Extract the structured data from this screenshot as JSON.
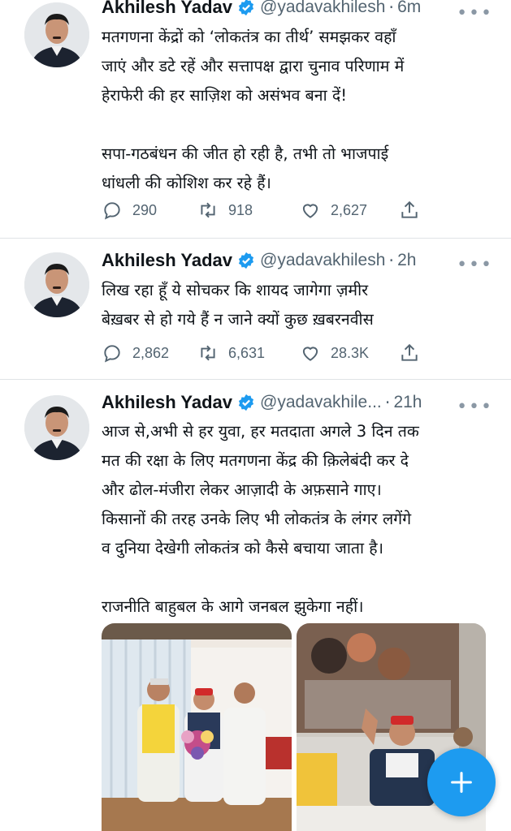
{
  "tweets": [
    {
      "name": "Akhilesh Yadav",
      "handle": "@yadavakhilesh",
      "time": "6m",
      "lines": [
        "मतगणना केंद्रों को ‘लोकतंत्र का तीर्थ’ समझकर वहाँ",
        "जाएं और डटे रहें और सत्तापक्ष द्वारा चुनाव परिणाम में",
        "हेराफेरी की हर साज़िश को असंभव बना दें!",
        "",
        "सपा-गठबंधन की जीत हो रही है, तभी तो भाजपाई",
        "धांधली की कोशिश कर रहे हैं।"
      ],
      "replies": "290",
      "retweets": "918",
      "likes": "2,627"
    },
    {
      "name": "Akhilesh Yadav",
      "handle": "@yadavakhilesh",
      "time": "2h",
      "lines": [
        "लिख रहा हूँ ये सोचकर कि शायद जागेगा ज़मीर",
        "बेख़बर से हो गये हैं न जाने क्यों कुछ ख़बरनवीस"
      ],
      "replies": "2,862",
      "retweets": "6,631",
      "likes": "28.3K"
    },
    {
      "name": "Akhilesh Yadav",
      "handle": "@yadavakhile...",
      "time": "21h",
      "lines": [
        "आज से,अभी से हर युवा, हर मतदाता अगले 3 दिन तक",
        "मत की रक्षा के लिए मतगणना केंद्र की क़िलेबंदी कर दे",
        "और ढोल-मंजीरा लेकर आज़ादी के अफ़साने गाए।",
        "किसानों की तरह उनके लिए भी लोकतंत्र के लंगर लगेंगे",
        "व दुनिया देखेगी लोकतंत्र को कैसे बचाया जाता है।",
        "",
        "राजनीति बाहुबल के आगे जनबल झुकेगा नहीं।"
      ]
    }
  ],
  "colors": {
    "accent": "#1d9bf0",
    "secondary_text": "#536471",
    "divider": "#dfe3e6"
  },
  "icons": [
    "verified-badge-icon",
    "reply-icon",
    "retweet-icon",
    "like-icon",
    "share-icon",
    "more-icon",
    "compose-plus-icon"
  ]
}
